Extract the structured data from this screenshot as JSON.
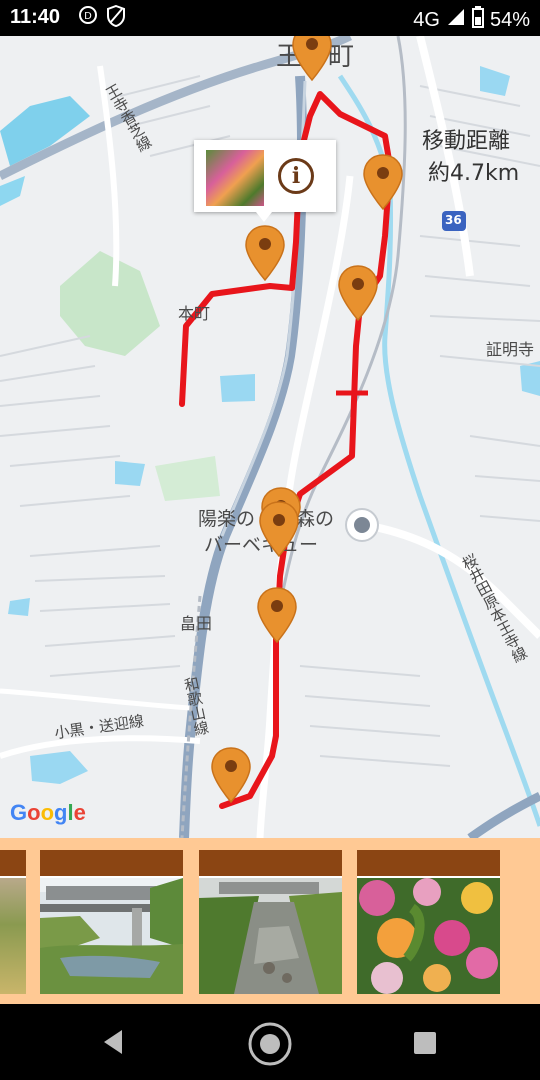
{
  "status": {
    "time": "11:40",
    "network": "4G",
    "battery": "54%"
  },
  "map": {
    "labels": {
      "ouji_town": "王寺町",
      "ouji_kashiba_line": "王寺香芝線",
      "honmachi": "本町",
      "youraku_1": "陽楽の",
      "youraku_2": "森の",
      "youraku_3": "バーベキュー",
      "hatakeda": "畠田",
      "wakayama_line": "和歌山線",
      "ooguro_line": "小黒・送迎線",
      "sakurai_line": "桜井田原本王寺線",
      "shomeiji": "証明寺",
      "route_36": "36"
    },
    "distance_label": "移動距離",
    "distance_value": "約4.7km",
    "google_logo": "Google",
    "route_color": "#e8151b",
    "pin_color": "#e8912e",
    "info_symbol": "i"
  },
  "gallery": {
    "background": "#ffc994",
    "card_header_color": "#8b4513",
    "photos": [
      "photo-partial",
      "photo-station-bridge",
      "photo-river",
      "photo-flowers"
    ]
  },
  "navbar": {
    "buttons": [
      "back",
      "home",
      "recents"
    ]
  }
}
